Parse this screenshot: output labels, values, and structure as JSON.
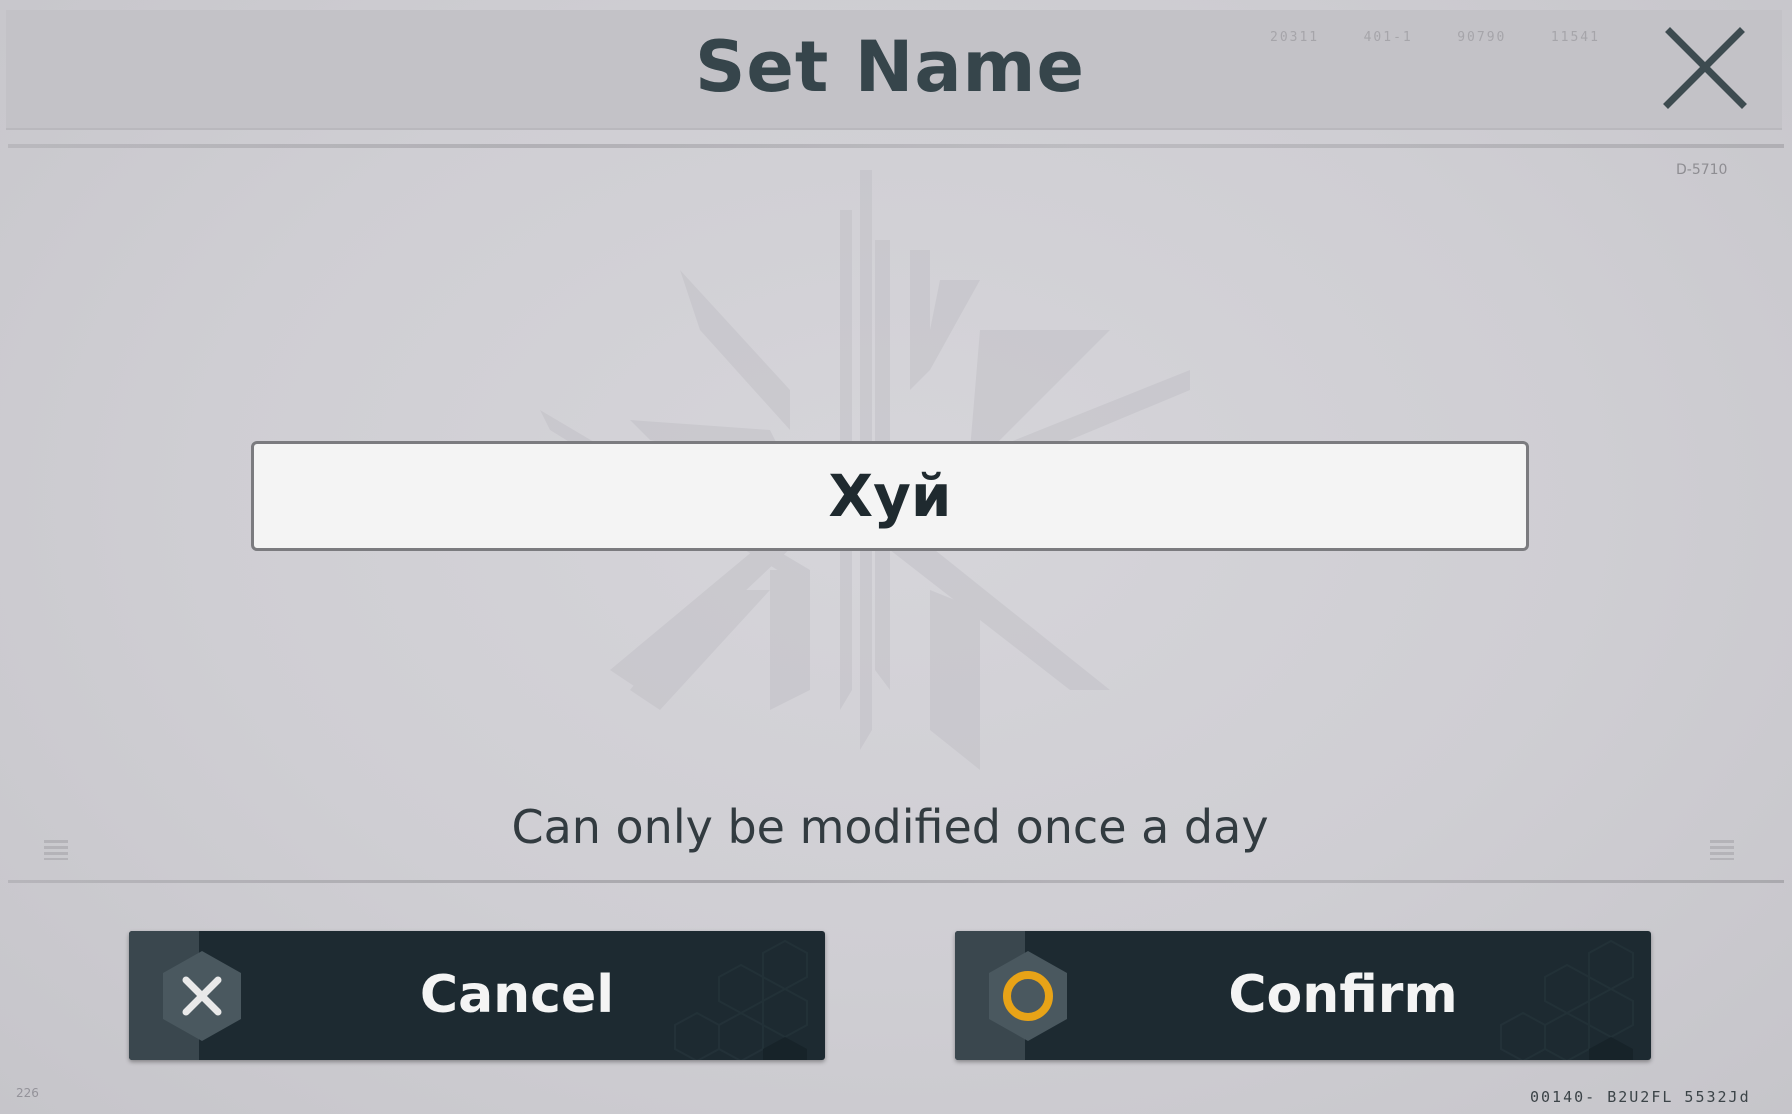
{
  "dialog": {
    "title": "Set Name",
    "serial_codes": [
      "20311",
      "401-1",
      "90790",
      "11541"
    ],
    "corner_code": "D-5710"
  },
  "name_field": {
    "value": "Хуй"
  },
  "hint": "Can only be modified once a day",
  "buttons": {
    "cancel_label": "Cancel",
    "confirm_label": "Confirm"
  },
  "footer": {
    "left_code": "226",
    "right_code": "00140-  B2U2FL  5532Jd"
  },
  "colors": {
    "button_bg": "#1d2a31",
    "confirm_accent": "#e8a317",
    "title_text": "#36454b"
  },
  "icons": {
    "close": "close-x-icon",
    "cancel": "hex-x-icon",
    "confirm": "hex-circle-icon"
  }
}
